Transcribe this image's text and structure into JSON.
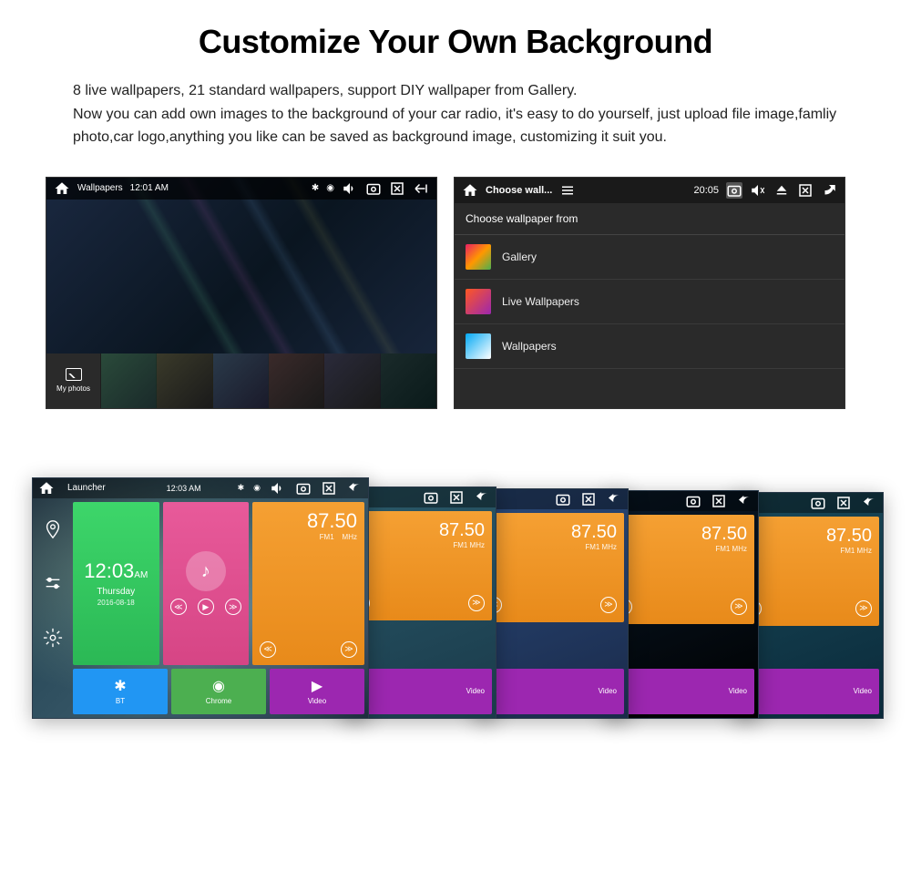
{
  "header": {
    "title": "Customize Your Own Background",
    "description": "8 live wallpapers, 21 standard wallpapers, support DIY wallpaper from Gallery.\nNow you can add own images to the background of your car radio, it's easy to do yourself, just upload file image,famliy photo,car logo,anything you like can be saved as background image, customizing it suit you."
  },
  "wallpaper_screen": {
    "title": "Wallpapers",
    "time": "12:01 AM",
    "photos_label": "My photos"
  },
  "chooser_screen": {
    "title": "Choose wall...",
    "time": "20:05",
    "header": "Choose wallpaper from",
    "options": [
      {
        "label": "Gallery",
        "icon": "gallery"
      },
      {
        "label": "Live Wallpapers",
        "icon": "live"
      },
      {
        "label": "Wallpapers",
        "icon": "wallpapers"
      }
    ]
  },
  "launcher": {
    "topbar_title": "Launcher",
    "topbar_time": "12:03 AM",
    "clock": {
      "time": "12:03",
      "am": "AM",
      "day": "Thursday",
      "date": "2016-08-18"
    },
    "radio": {
      "freq": "87.50",
      "band": "FM1",
      "unit": "MHz"
    },
    "apps": {
      "bt": "BT",
      "chrome": "Chrome",
      "video": "Video"
    }
  }
}
